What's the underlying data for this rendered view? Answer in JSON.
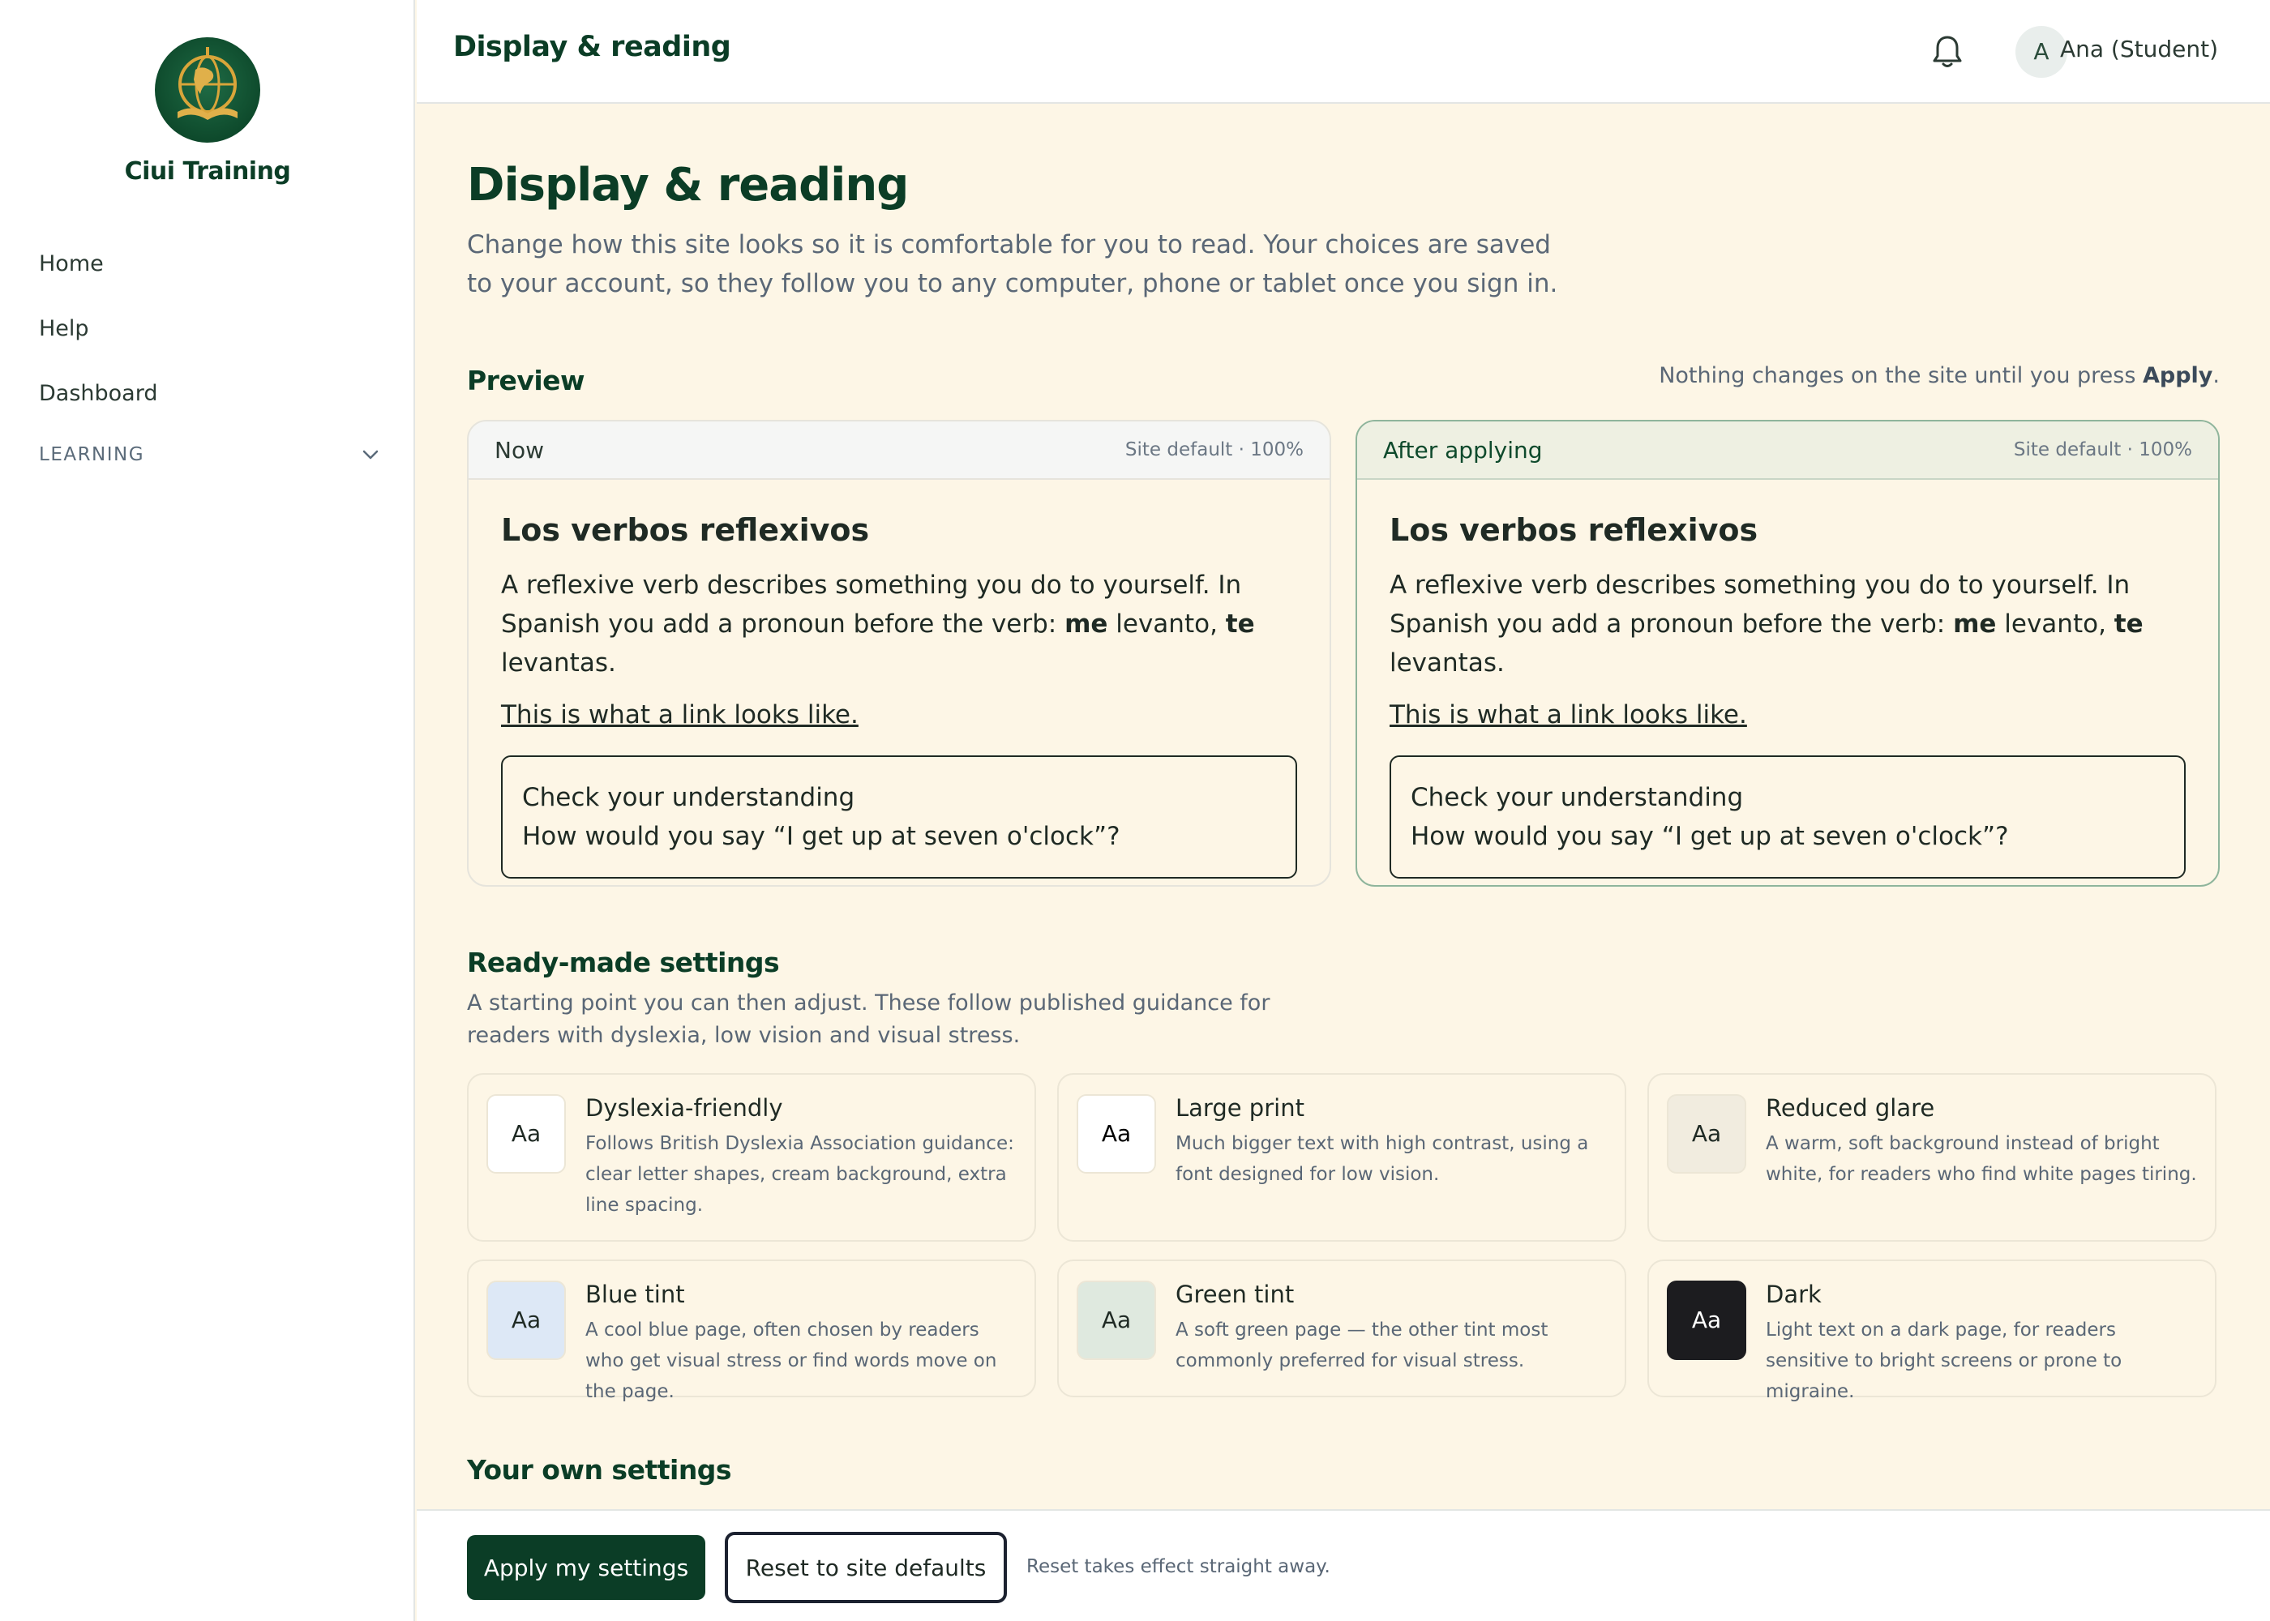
{
  "brand": {
    "name": "Ciui Training",
    "logo_icon": "globe-book-logo"
  },
  "nav": {
    "items": [
      {
        "label": "Home"
      },
      {
        "label": "Help"
      },
      {
        "label": "Dashboard"
      }
    ],
    "section": {
      "label": "LEARNING",
      "icon": "chevron-down-icon"
    }
  },
  "topbar": {
    "title": "Display & reading",
    "bell_icon": "bell-icon",
    "avatar_initial": "A",
    "user_name": "Ana (Student)"
  },
  "page": {
    "title": "Display & reading",
    "intro": "Change how this site looks so it is comfortable for you to read. Your choices are saved to your account, so they follow you to any computer, phone or tablet once you sign in."
  },
  "preview": {
    "heading": "Preview",
    "note_prefix": "Nothing changes on the site until you press ",
    "note_action": "Apply",
    "note_suffix": ".",
    "cards": [
      {
        "label": "Now",
        "scale": "Site default · 100%",
        "title": "Los verbos reflexivos",
        "text_1": "A reflexive verb describes something you do to yourself. In Spanish you add a pronoun before the verb: ",
        "bold_1": "me",
        "text_2": " levanto, ",
        "bold_2": "te",
        "text_3": " levantas.",
        "link": "This is what a link looks like.",
        "check_title": "Check your understanding",
        "check_question": "How would you say “I get up at seven o'clock”?"
      },
      {
        "label": "After applying",
        "scale": "Site default · 100%",
        "title": "Los verbos reflexivos",
        "text_1": "A reflexive verb describes something you do to yourself. In Spanish you add a pronoun before the verb: ",
        "bold_1": "me",
        "text_2": " levanto, ",
        "bold_2": "te",
        "text_3": " levantas.",
        "link": "This is what a link looks like.",
        "check_title": "Check your understanding",
        "check_question": "How would you say “I get up at seven o'clock”?"
      }
    ]
  },
  "ready": {
    "heading": "Ready-made settings",
    "description": "A starting point you can then adjust. These follow published guidance for readers with dyslexia, low vision and visual stress.",
    "presets": [
      {
        "swatch": "Aa",
        "name": "Dyslexia-friendly",
        "description": "Follows British Dyslexia Association guidance: clear letter shapes, cream background, extra line spacing.",
        "bg": "#ffffff",
        "fg": "#1f2a24"
      },
      {
        "swatch": "Aa",
        "name": "Large print",
        "description": "Much bigger text with high contrast, using a font designed for low vision.",
        "bg": "#ffffff",
        "fg": "#000000"
      },
      {
        "swatch": "Aa",
        "name": "Reduced glare",
        "description": "A warm, soft background instead of bright white, for readers who find white pages tiring.",
        "bg": "#f1ecdf",
        "fg": "#1f2a24"
      },
      {
        "swatch": "Aa",
        "name": "Blue tint",
        "description": "A cool blue page, often chosen by readers who get visual stress or find words move on the page.",
        "bg": "#dde8f6",
        "fg": "#1f2a24"
      },
      {
        "swatch": "Aa",
        "name": "Green tint",
        "description": "A soft green page — the other tint most commonly preferred for visual stress.",
        "bg": "#dfe9df",
        "fg": "#1f2a24"
      },
      {
        "swatch": "Aa",
        "name": "Dark",
        "description": "Light text on a dark page, for readers sensitive to bright screens or prone to migraine.",
        "bg": "#1c1c1f",
        "fg": "#ffffff"
      }
    ]
  },
  "own": {
    "heading": "Your own settings"
  },
  "actions": {
    "apply_label": "Apply my settings",
    "reset_label": "Reset to site defaults",
    "reset_note": "Reset takes effect straight away."
  }
}
